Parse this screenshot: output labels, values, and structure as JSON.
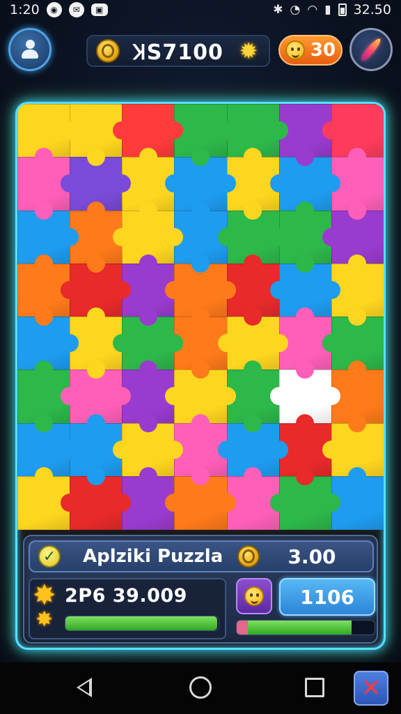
{
  "status_bar": {
    "time": "1:20",
    "clock": "32.50"
  },
  "header": {
    "coin_amount": "ꞰS7100",
    "lives": "30"
  },
  "panel": {
    "title": "Aplziki Puzzla",
    "price": "3.00",
    "stat": "2P6 39.009",
    "xp_fraction": 0.99,
    "level": "1106",
    "progress_fraction": 0.75
  },
  "board": {
    "cols": 7,
    "rows": 8,
    "colors": [
      [
        "#ffd61f",
        "#ffd61f",
        "#ff3b3b",
        "#2db84a",
        "#2db84a",
        "#9a3bd0",
        "#ff3b5c"
      ],
      [
        "#ff5fb8",
        "#7a4ad8",
        "#ffd61f",
        "#1e9cf0",
        "#ffd61f",
        "#1e9cf0",
        "#ff5fb8"
      ],
      [
        "#1e9cf0",
        "#ff7a1a",
        "#ffd61f",
        "#1e9cf0",
        "#2db84a",
        "#2db84a",
        "#9a3bd0"
      ],
      [
        "#ff7a1a",
        "#e82a2a",
        "#9a3bd0",
        "#ff7a1a",
        "#e82a2a",
        "#1e9cf0",
        "#ffd61f"
      ],
      [
        "#1e9cf0",
        "#ffd61f",
        "#2db84a",
        "#ff7a1a",
        "#ffd61f",
        "#ff5fb8",
        "#2db84a"
      ],
      [
        "#2db84a",
        "#ff5fb8",
        "#9a3bd0",
        "#ffd61f",
        "#2db84a",
        "#ffffff",
        "#ff7a1a"
      ],
      [
        "#1e9cf0",
        "#1e9cf0",
        "#ffd61f",
        "#ff5fb8",
        "#1e9cf0",
        "#e82a2a",
        "#ffd61f"
      ],
      [
        "#ffd61f",
        "#e82a2a",
        "#9a3bd0",
        "#ff7a1a",
        "#ff5fb8",
        "#2db84a",
        "#1e9cf0"
      ]
    ]
  }
}
